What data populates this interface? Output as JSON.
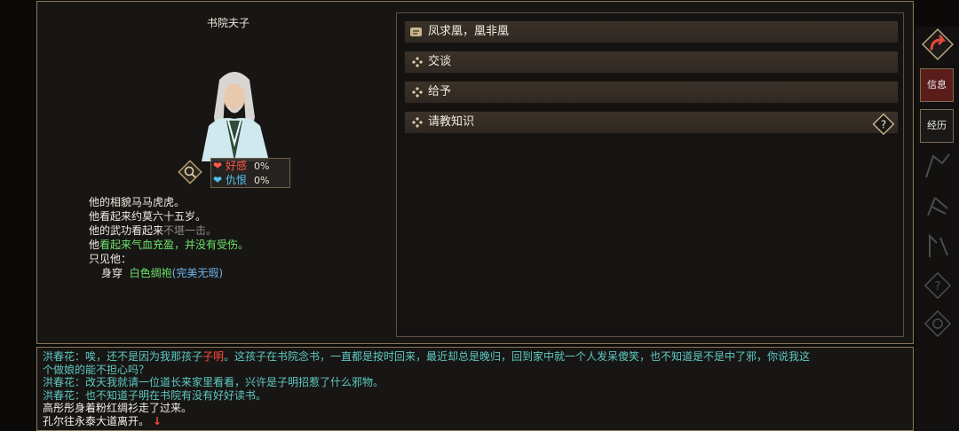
{
  "npc": {
    "title": "书院夫子",
    "stats": [
      {
        "label": "好感",
        "value": "0%",
        "color": "#ff5a4a"
      },
      {
        "label": "仇恨",
        "value": "0%",
        "color": "#4fc3f0"
      }
    ]
  },
  "description": {
    "line1": "他的相貌马马虎虎。",
    "line2": "他看起来约莫六十五岁。",
    "line3_prefix": "他的武功看起来",
    "line3_status": "不堪一击。",
    "line4_prefix": "他",
    "line4_status": "看起来气血充盈，并没有受伤。",
    "line5": "只见他：",
    "wear_label": "身穿",
    "wear_item": "白色绸袍",
    "wear_quality": "(完美无瑕)"
  },
  "actions": [
    {
      "label": "凤求凰，凰非凰",
      "icon": "quest-tag-icon"
    },
    {
      "label": "交谈",
      "icon": "diamond-bullet-icon"
    },
    {
      "label": "给予",
      "icon": "diamond-bullet-icon"
    },
    {
      "label": "请教知识",
      "icon": "diamond-bullet-icon",
      "help": "?"
    }
  ],
  "side_menu": {
    "info": "信息",
    "experience": "经历"
  },
  "log": {
    "line1_speaker": "洪春花：",
    "line1_a": "唉，还不是因为我那孩子",
    "line1_name": "子明",
    "line1_b": "。这孩子在书院念书，一直都是按时回来，最近却总是晚归，回到家中就一个人发呆傻笑，也不知道是不是中了邪，你说我这",
    "line2": "个做娘的能不担心吗？",
    "line3": "洪春花：改天我就请一位道长来家里看看，兴许是子明招惹了什么邪物。",
    "line4": "洪春花：也不知道子明在书院有没有好好读书。",
    "line5": "高彤彤身着粉红绸衫走了过来。",
    "line6": "孔尔往永泰大道离开。",
    "line6_arrow": "↓"
  }
}
